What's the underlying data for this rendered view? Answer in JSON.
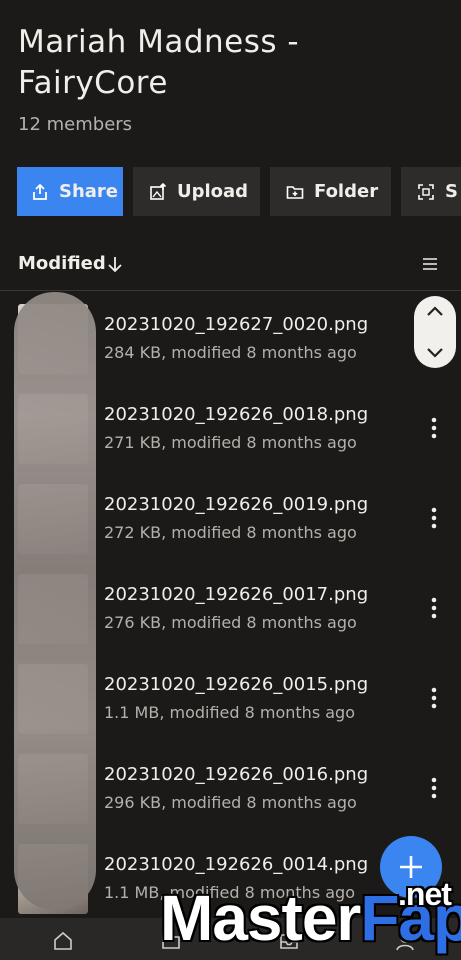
{
  "folder": {
    "title": "Mariah Madness - FairyCore",
    "members": "12 members"
  },
  "toolbar": {
    "share_label": "Share",
    "upload_label": "Upload",
    "folder_label": "Folder",
    "scan_label": "S"
  },
  "sort": {
    "label": "Modified",
    "direction": "descending"
  },
  "files": [
    {
      "name": "20231020_192627_0020.png",
      "meta": "284 KB, modified 8 months ago"
    },
    {
      "name": "20231020_192626_0018.png",
      "meta": "271 KB, modified 8 months ago"
    },
    {
      "name": "20231020_192626_0019.png",
      "meta": "272 KB, modified 8 months ago"
    },
    {
      "name": "20231020_192626_0017.png",
      "meta": "276 KB, modified 8 months ago"
    },
    {
      "name": "20231020_192626_0015.png",
      "meta": "1.1 MB, modified 8 months ago"
    },
    {
      "name": "20231020_192626_0016.png",
      "meta": "296 KB, modified 8 months ago"
    },
    {
      "name": "20231020_192626_0014.png",
      "meta": "1.1 MB, modified 8 months ago"
    }
  ],
  "watermark": {
    "part1": "Master",
    "part2": "Fap",
    "tld": ".net"
  },
  "colors": {
    "background": "#1b1a19",
    "accent": "#3a85f0",
    "button": "#2e2c2a",
    "text_secondary": "#b5b0aa"
  },
  "icons": {
    "share": "share-upload-icon",
    "upload": "image-upload-icon",
    "folder": "folder-plus-icon",
    "scan": "scan-icon",
    "sort": "arrow-down-icon",
    "view": "list-view-icon",
    "more": "more-vertical-icon",
    "fab": "plus-icon",
    "scroll": "scroll-up-down-icon"
  }
}
